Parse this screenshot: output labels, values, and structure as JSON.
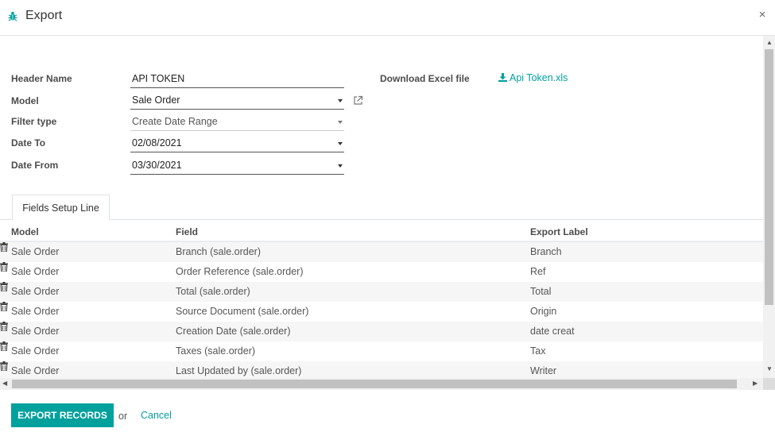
{
  "dialog": {
    "title": "Export",
    "close_symbol": "×",
    "title_icon": "bug-icon"
  },
  "form": {
    "header_name_label": "Header Name",
    "header_name_value": "API TOKEN",
    "model_label": "Model",
    "model_value": "Sale Order",
    "filter_type_label": "Filter type",
    "filter_type_value": "Create Date Range",
    "date_to_label": "Date To",
    "date_to_value": "02/08/2021",
    "date_from_label": "Date From",
    "date_from_value": "03/30/2021",
    "download_label": "Download Excel file",
    "download_file": "Api Token.xls"
  },
  "tabs": [
    {
      "label": "Fields Setup Line"
    }
  ],
  "table": {
    "columns": [
      "Model",
      "Field",
      "Export Label"
    ],
    "rows": [
      {
        "model": "Sale Order",
        "field": "Branch (sale.order)",
        "label": "Branch"
      },
      {
        "model": "Sale Order",
        "field": "Order Reference (sale.order)",
        "label": "Ref"
      },
      {
        "model": "Sale Order",
        "field": "Total (sale.order)",
        "label": "Total"
      },
      {
        "model": "Sale Order",
        "field": "Source Document (sale.order)",
        "label": "Origin"
      },
      {
        "model": "Sale Order",
        "field": "Creation Date (sale.order)",
        "label": "date creat"
      },
      {
        "model": "Sale Order",
        "field": "Taxes (sale.order)",
        "label": "Tax"
      },
      {
        "model": "Sale Order",
        "field": "Last Updated by (sale.order)",
        "label": "Writer"
      }
    ]
  },
  "footer": {
    "export_label": "EXPORT RECORDS",
    "or_text": "or",
    "cancel_label": "Cancel"
  },
  "colors": {
    "accent": "#00A09D"
  }
}
